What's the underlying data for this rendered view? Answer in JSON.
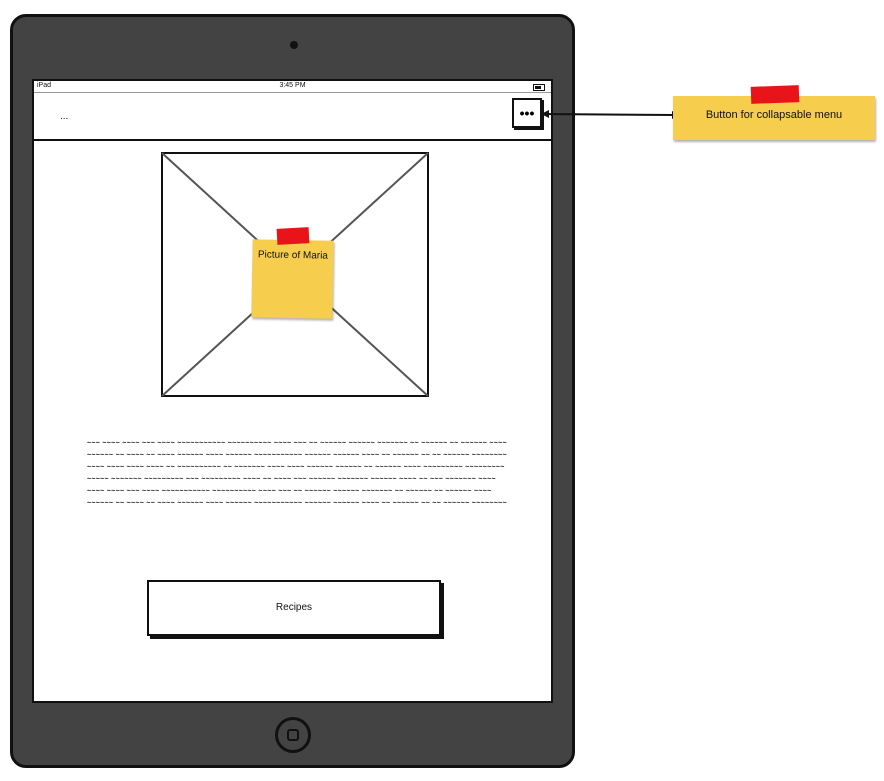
{
  "status_bar": {
    "device": "iPad",
    "time": "3:45 PM"
  },
  "navbar": {
    "title": "...",
    "menu_button_label": "•••"
  },
  "image": {
    "note": "Picture of Maria"
  },
  "body_text": "~~~ ~~~~ ~~~~ ~~~ ~~~~ ~~~~~~~~~~~ ~~~~~~~~~~ ~~~~ ~~~ ~~ ~~~~~~ ~~~~~~ ~~~~~~~ ~~ ~~~~~~ ~~ ~~~~~~ ~~~~ ~~~~~~ ~~ ~~~~ ~~ ~~~~ ~~~~~~ ~~~~ ~~~~~~ ~~~~~~~~~~~ ~~~~~~ ~~~~~~ ~~~~ ~~ ~~~~~~ ~~ ~~ ~~~~~~ ~~~~~~~~ ~~~~ ~~~~ ~~~~ ~~~~ ~~ ~~~~~~~~~~ ~~ ~~~~~~~ ~~~~ ~~~~ ~~~~~~ ~~~~~~ ~~ ~~~~~~ ~~~~ ~~~~~~~~~ ~~~~~~~~~ ~~~~~ ~~~~~~~ ~~~~~~~~~ ~~~ ~~~~~~~~~ ~~~~ ~~ ~~~~ ~~~ ~~~~~~ ~~~~~~~ ~~~~~~ ~~~~ ~~ ~~~ ~~~~~~~ ~~~~ ~~~~ ~~~~ ~~~ ~~~~ ~~~~~~~~~~~ ~~~~~~~~~~ ~~~~ ~~~ ~~ ~~~~~~ ~~~~~~ ~~~~~~~ ~~ ~~~~~~ ~~ ~~~~~~ ~~~~ ~~~~~~ ~~ ~~~~ ~~ ~~~~ ~~~~~~ ~~~~ ~~~~~~ ~~~~~~~~~~~ ~~~~~~ ~~~~~~ ~~~~ ~~ ~~~~~~ ~~ ~~ ~~~~~~ ~~~~~~~~",
  "recipes_button": {
    "label": "Recipes"
  },
  "annotation": {
    "label": "Button for collapsable menu"
  },
  "colors": {
    "sticky": "#f6cd4c",
    "tape": "#e8141a",
    "device": "#434343"
  }
}
